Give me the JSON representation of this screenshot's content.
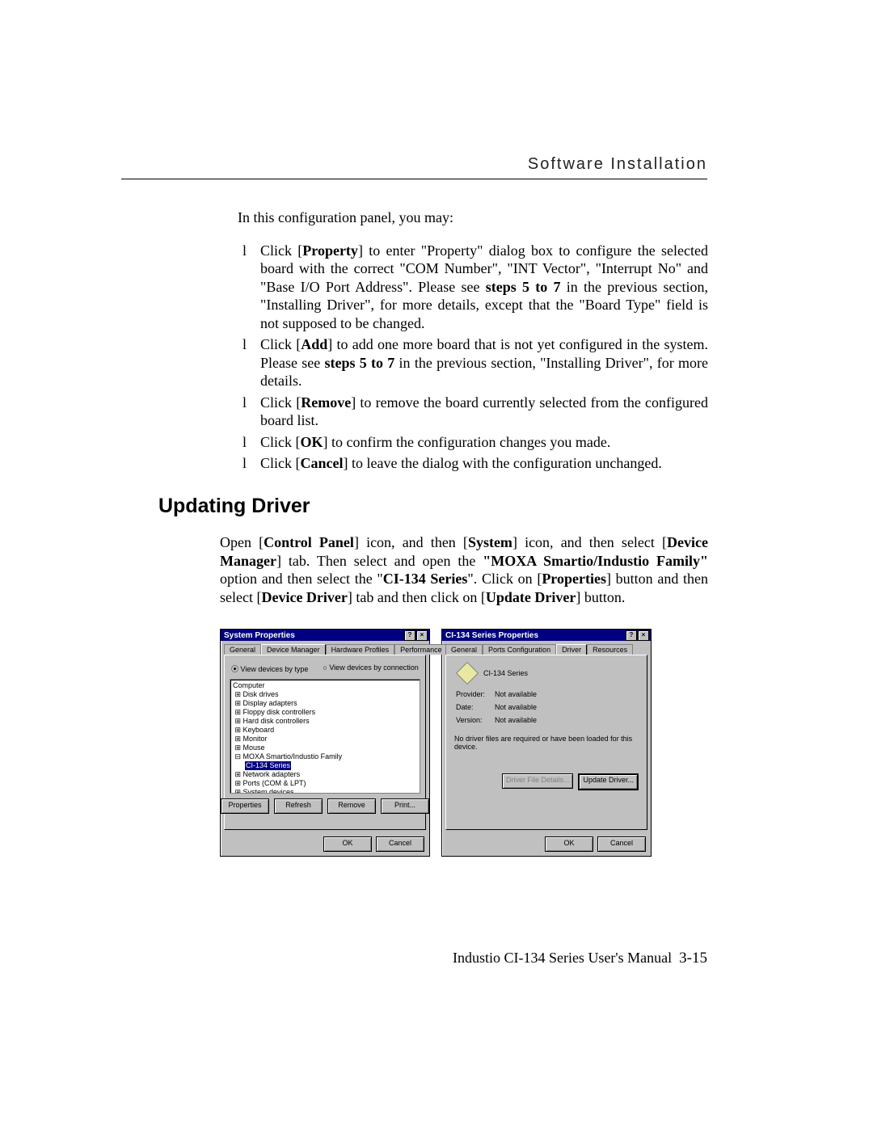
{
  "header": {
    "title": "Software Installation"
  },
  "body": {
    "intro": "In this configuration panel, you may:",
    "bullets": [
      {
        "pre": "Click [",
        "bold": "Property",
        "post": "] to enter \"Property\" dialog box to configure the selected board with the correct \"COM Number\", \"INT Vector\", \"Interrupt No\" and \"Base I/O Port Address\". Please see ",
        "bold2": "steps 5 to 7",
        "post2": " in the previous section, \"Installing Driver\", for more details, except that the \"Board Type\" field is not supposed to be changed."
      },
      {
        "pre": "Click [",
        "bold": "Add",
        "post": "] to add one more board that is not yet configured in the system. Please see ",
        "bold2": "steps 5 to 7",
        "post2": " in the previous section, \"Installing Driver\", for more details."
      },
      {
        "pre": "Click [",
        "bold": "Remove",
        "post": "] to remove the board currently selected from the configured board list."
      },
      {
        "pre": "Click [",
        "bold": "OK",
        "post": "] to confirm the configuration changes you made."
      },
      {
        "pre": "Click [",
        "bold": "Cancel",
        "post": "] to leave the dialog with the configuration unchanged."
      }
    ]
  },
  "section": {
    "heading": "Updating Driver",
    "body_parts": [
      {
        "t": "Open ["
      },
      {
        "b": "Control Panel"
      },
      {
        "t": "] icon, and then ["
      },
      {
        "b": "System"
      },
      {
        "t": "] icon, and then select ["
      },
      {
        "b": "Device Manager"
      },
      {
        "t": "] tab. Then select and open the "
      },
      {
        "b": "\"MOXA Smartio/Industio Family\""
      },
      {
        "t": " option and then select the \""
      },
      {
        "b": "CI-134 Series"
      },
      {
        "t": "\". Click on ["
      },
      {
        "b": "Properties"
      },
      {
        "t": "] button and then select ["
      },
      {
        "b": "Device Driver"
      },
      {
        "t": "] tab and then click on ["
      },
      {
        "b": "Update Driver"
      },
      {
        "t": "] button."
      }
    ]
  },
  "sysprops": {
    "title": "System Properties",
    "tabs": [
      "General",
      "Device Manager",
      "Hardware Profiles",
      "Performance"
    ],
    "active_tab": 1,
    "radio": {
      "a": "View devices by type",
      "b": "View devices by connection"
    },
    "tree": [
      "Computer",
      " ⊞ Disk drives",
      " ⊞ Display adapters",
      " ⊞ Floppy disk controllers",
      " ⊞ Hard disk controllers",
      " ⊞ Keyboard",
      " ⊞ Monitor",
      " ⊞ Mouse",
      " ⊟ MOXA Smartio/Industio Family"
    ],
    "tree_sel": "CI-134 Series",
    "tree_after": [
      " ⊞ Network adapters",
      " ⊞ Ports (COM & LPT)",
      " ⊞ System devices"
    ],
    "buttons": [
      "Properties",
      "Refresh",
      "Remove",
      "Print..."
    ],
    "bottom": [
      "OK",
      "Cancel"
    ]
  },
  "drvprops": {
    "title": "CI-134 Series Properties",
    "tabs": [
      "General",
      "Ports Configuration",
      "Driver",
      "Resources"
    ],
    "active_tab": 2,
    "device": "CI-134 Series",
    "fields": [
      {
        "lab": "Provider:",
        "val": "Not available"
      },
      {
        "lab": "Date:",
        "val": "Not available"
      },
      {
        "lab": "Version:",
        "val": "Not available"
      }
    ],
    "note": "No driver files are required or have been loaded for this device.",
    "buttons": {
      "detail": "Driver File Details...",
      "update": "Update Driver..."
    },
    "bottom": [
      "OK",
      "Cancel"
    ]
  },
  "footer": {
    "text": "Industio CI-134 Series User's Manual",
    "page": "3-15"
  }
}
